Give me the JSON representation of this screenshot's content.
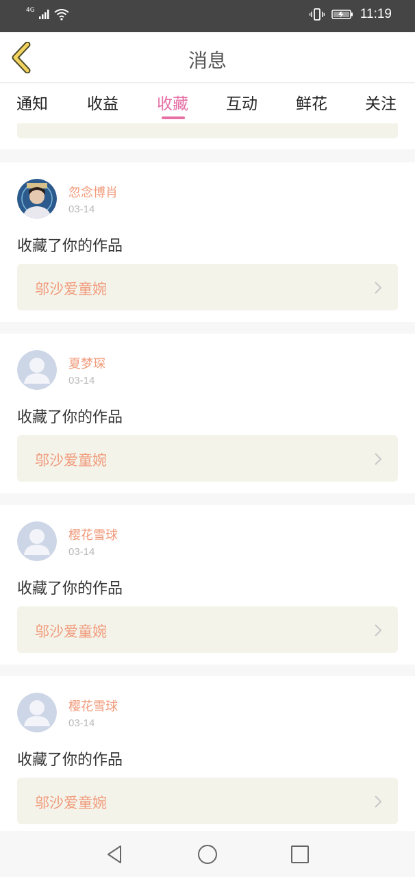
{
  "status_bar": {
    "network": "4G",
    "time": "11:19"
  },
  "header": {
    "title": "消息"
  },
  "tabs": [
    {
      "label": "通知"
    },
    {
      "label": "收益"
    },
    {
      "label": "收藏",
      "active": true
    },
    {
      "label": "互动"
    },
    {
      "label": "鲜花"
    },
    {
      "label": "关注"
    }
  ],
  "messages": [
    {
      "username": "忽念博肖",
      "date": "03-14",
      "action": "收藏了你的作品",
      "work_title": "邬沙爱童婉",
      "avatar": "photo-avatar"
    },
    {
      "username": "夏梦琛",
      "date": "03-14",
      "action": "收藏了你的作品",
      "work_title": "邬沙爱童婉",
      "avatar": "default-avatar"
    },
    {
      "username": "樱花雪球",
      "date": "03-14",
      "action": "收藏了你的作品",
      "work_title": "邬沙爱童婉",
      "avatar": "default-avatar"
    },
    {
      "username": "樱花雪球",
      "date": "03-14",
      "action": "收藏了你的作品",
      "work_title": "邬沙爱童婉",
      "avatar": "default-avatar"
    }
  ],
  "colors": {
    "accent": "#e66fa4",
    "name_orange": "#f09a7a",
    "link_bg": "#f4f3ea",
    "status_bar": "#454545"
  }
}
